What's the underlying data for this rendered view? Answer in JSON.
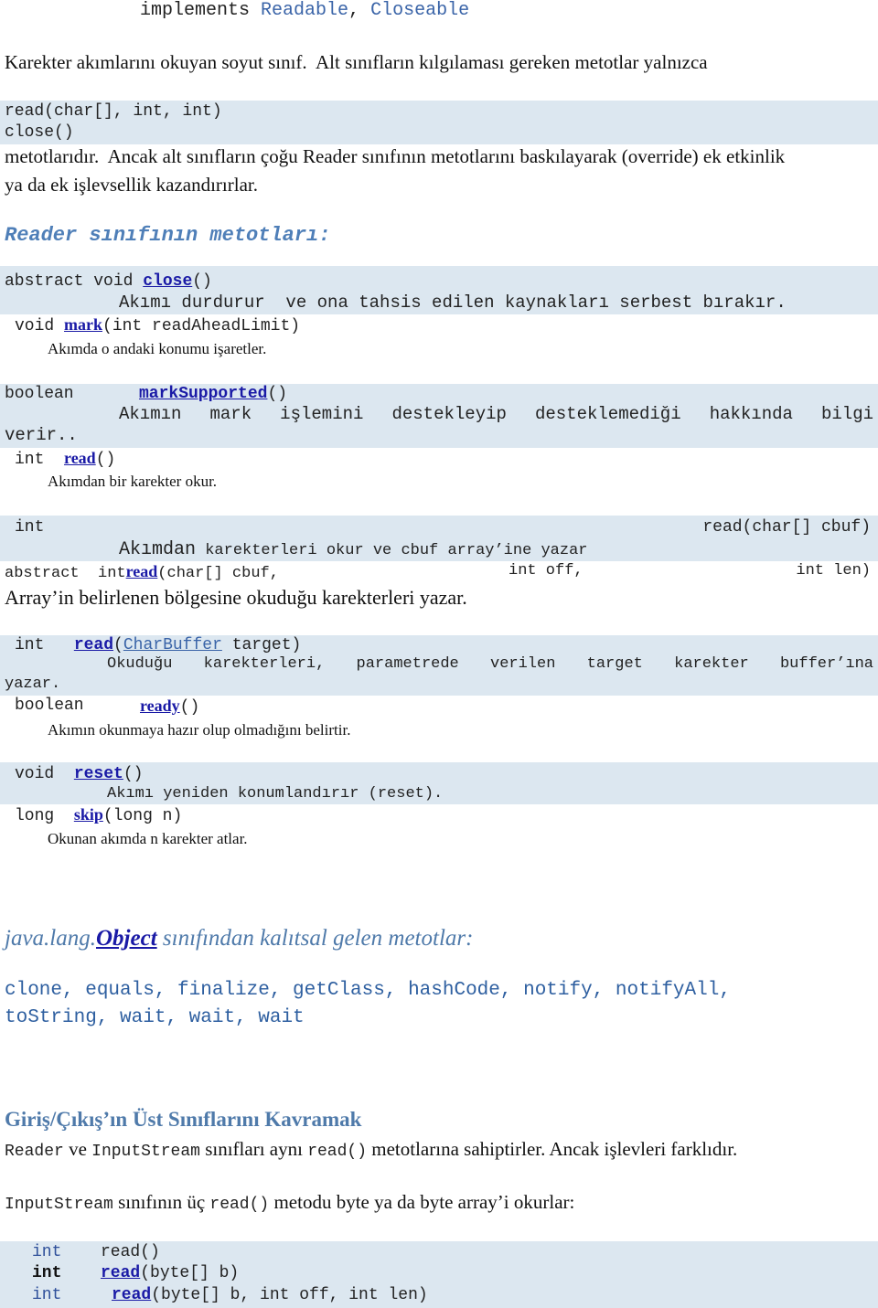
{
  "header": {
    "implements_kw": "implements",
    "iface1": "Readable",
    "sep": ", ",
    "iface2": "Closeable"
  },
  "intro": {
    "line1": "Karekter akımlarını okuyan soyut sınıf.  Alt sınıfların kılgılaması gereken metotlar yalnızca",
    "code1": "read(char[], int, int)",
    "code2": "close()",
    "line2": "metotlarıdır.  Ancak alt sınıfların çoğu Reader sınıfının metotlarını baskılayarak (override) ek etkinlik",
    "line3": "ya da ek işlevsellik kazandırırlar."
  },
  "methods_heading": "Reader sınıfının metotları:",
  "methods": {
    "close": {
      "mod": "abstract void ",
      "name": "close",
      "params": "()",
      "desc": "Akımı durdurur  ve ona tahsis edilen kaynakları serbest bırakır."
    },
    "mark": {
      "mod": "void ",
      "name": "mark",
      "params": "(int readAheadLimit)",
      "desc": "Akımda o andaki konumu işaretler."
    },
    "markSupported": {
      "mod": "boolean",
      "name": "markSupported",
      "params": "()",
      "desc": "Akımın mark işlemini destekleyip desteklemediği hakkında bilgi",
      "desc2": "verir.."
    },
    "read0": {
      "mod": "int ",
      "name": "read",
      "params": "()",
      "desc": "Akımdan bir karekter okur."
    },
    "read1": {
      "mod": "int",
      "sig": "read(char[] cbuf)",
      "desc_a": "Akımdan",
      "desc_b": " karekterleri okur ve cbuf array’ine yazar"
    },
    "read3": {
      "mod": "abstract  int",
      "name": "read",
      "p1": "(char[] cbuf,",
      "p2": "int off,",
      "p3": "int len)",
      "desc": "Array’in belirlenen bölgesine okuduğu karekterleri yazar."
    },
    "readCb": {
      "mod": "int ",
      "name": "read",
      "open": "(",
      "type": "CharBuffer",
      "rest": " target)",
      "desc": "Okuduğu karekterleri, parametrede verilen target karekter buffer’ına",
      "desc2": "yazar."
    },
    "ready": {
      "mod": "boolean",
      "name": "ready",
      "params": "()",
      "desc": "Akımın okunmaya hazır olup olmadığını belirtir."
    },
    "reset": {
      "mod": "void ",
      "name": "reset",
      "params": "()",
      "desc": "Akımı yeniden konumlandırır (reset)."
    },
    "skip": {
      "mod": "long ",
      "name": "skip",
      "params": "(long n)",
      "desc": "Okunan akımda n karekter atlar."
    }
  },
  "inherited": {
    "prefix": "java.lang.",
    "object": "Object",
    "suffix": " sınıfından kalıtsal gelen metotlar:",
    "line1": "clone, equals, finalize, getClass, hashCode, notify, notifyAll,",
    "line2": "toString, wait, wait, wait"
  },
  "section": {
    "title": "Giriş/Çıkış’ın Üst Sınıflarını Kavramak",
    "p1_c1": "Reader",
    "p1_t1": " ve ",
    "p1_c2": "InputStream",
    "p1_t2": " sınıfları aynı ",
    "p1_c3": "read()",
    "p1_t3": " metotlarına sahiptirler. Ancak işlevleri farklıdır.",
    "p2_c1": "InputStream",
    "p2_t1": " sınıfının üç ",
    "p2_c2": "read()",
    "p2_t2": " metodu byte ya da byte array’i okurlar:"
  },
  "inputstream_reads": [
    {
      "type": "int",
      "name": "read",
      "params": "()"
    },
    {
      "type": "int",
      "name": "read",
      "params": "(byte[] b)"
    },
    {
      "type": "int",
      "name": "read",
      "params": "(byte[] b, int off, int len)"
    }
  ]
}
